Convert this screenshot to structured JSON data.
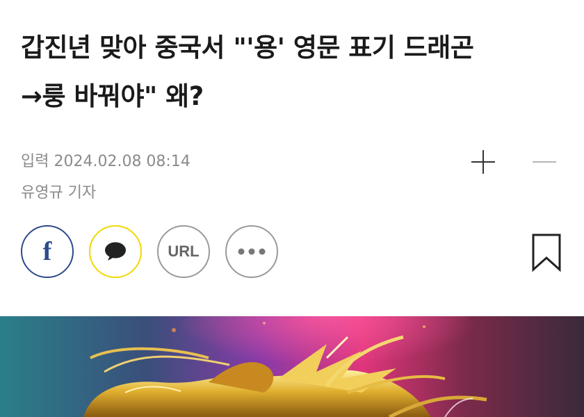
{
  "article": {
    "headline_line1": "갑진년 맞아 중국서 \"'용' 영문 표기 드래곤",
    "headline_line2": "→룽 바꿔야\" 왜?",
    "date": "입력 2024.02.08 08:14",
    "reporter": "유영규 기자"
  },
  "share": {
    "facebook_glyph": "f",
    "url_label": "URL"
  },
  "icons": {
    "font_increase": "plus-icon",
    "font_decrease": "minus-icon",
    "facebook": "facebook-icon",
    "kakao": "speech-bubble-icon",
    "more": "ellipsis-icon",
    "bookmark": "bookmark-icon",
    "hero": "golden-dragon-photo"
  },
  "colors": {
    "facebook": "#2d4a8a",
    "kakao": "#f0d800",
    "meta_text": "#8a8a8a",
    "headline": "#1a1a1a"
  }
}
